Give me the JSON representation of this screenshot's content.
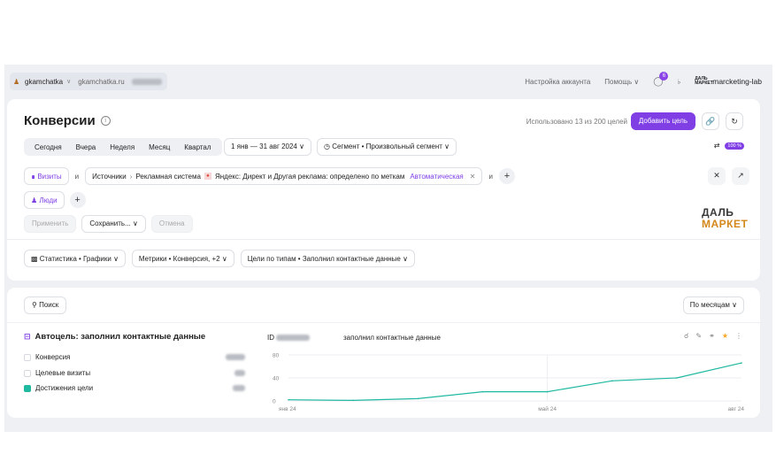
{
  "topbar": {
    "account": "gkamchatka",
    "site": "gkamchatka.ru",
    "account_settings": "Настройка аккаунта",
    "help": "Помощь",
    "notifications_count": "6",
    "brand": "marcketing-lab",
    "brand_logo_text": "ДАЛЬ МАРКЕТ"
  },
  "header": {
    "title": "Конверсии",
    "used_goals": "Использовано 13 из 200 целей",
    "add_goal": "Добавить цель"
  },
  "periods": [
    "Сегодня",
    "Вчера",
    "Неделя",
    "Месяц",
    "Квартал"
  ],
  "date_range": "1 янв — 31 авг 2024",
  "segment": "Сегмент • Произвольный сегмент",
  "sampling_badge": "100 %",
  "filters": {
    "visits": "Визиты",
    "and": "и",
    "source": "Источники",
    "system": "Рекламная система",
    "condition": "Яндекс: Директ и Другая реклама: определено по меткам",
    "auto": "Автоматическая",
    "people": "Люди"
  },
  "actions": {
    "apply": "Применить",
    "save": "Сохранить...",
    "cancel": "Отмена"
  },
  "report_settings": {
    "view": "Статистика • Графики",
    "metrics": "Метрики • Конверсия, +2",
    "goals": "Цели по типам • Заполнил контактные данные"
  },
  "toolbar": {
    "search": "Поиск",
    "group_by": "По месяцам"
  },
  "goal": {
    "title": "Автоцель: заполнил контактные данные",
    "id_label": "ID",
    "name": "заполнил контактные данные",
    "metrics": [
      {
        "label": "Конверсия",
        "checked": false
      },
      {
        "label": "Целевые визиты",
        "checked": false
      },
      {
        "label": "Достижения цели",
        "checked": true
      }
    ]
  },
  "colors": {
    "accent": "#7f3fe4",
    "line": "#1fb8a0"
  },
  "chart_data": {
    "type": "line",
    "x": [
      "янв 24",
      "фев 24",
      "мар 24",
      "апр 24",
      "май 24",
      "июн 24",
      "июл 24",
      "авг 24"
    ],
    "x_tick_labels": [
      "янв 24",
      "май 24",
      "авг 24"
    ],
    "series": [
      {
        "values": [
          2,
          1,
          4,
          16,
          16,
          35,
          40,
          66
        ]
      }
    ],
    "ylim": [
      0,
      80
    ],
    "y_ticks": [
      0,
      40,
      80
    ],
    "grid": true
  }
}
